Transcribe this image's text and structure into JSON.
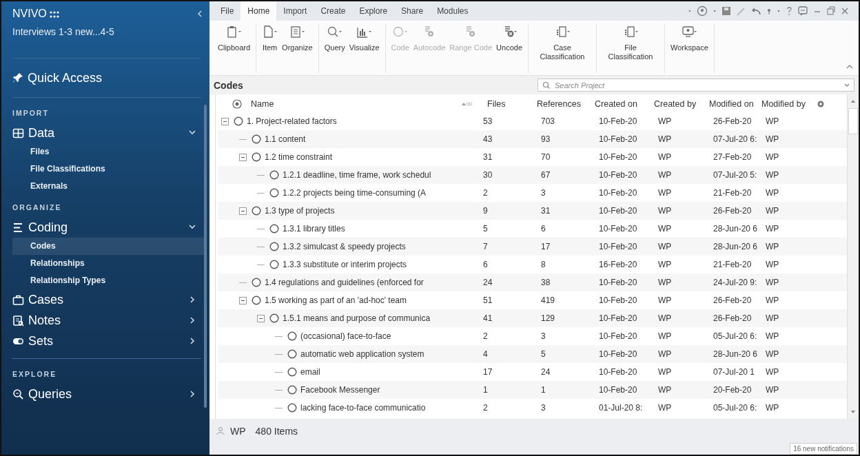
{
  "sidebar": {
    "logo": "NVIVO",
    "project": "Interviews 1-3 new...4-5",
    "quick_access": "Quick Access",
    "sections": [
      {
        "heading": "IMPORT",
        "groups": [
          {
            "label": "Data",
            "expanded": true,
            "children": [
              {
                "label": "Files",
                "selected": false
              },
              {
                "label": "File Classifications",
                "selected": false
              },
              {
                "label": "Externals",
                "selected": false
              }
            ]
          }
        ]
      },
      {
        "heading": "ORGANIZE",
        "groups": [
          {
            "label": "Coding",
            "expanded": true,
            "children": [
              {
                "label": "Codes",
                "selected": true
              },
              {
                "label": "Relationships",
                "selected": false
              },
              {
                "label": "Relationship Types",
                "selected": false
              }
            ]
          },
          {
            "label": "Cases",
            "expanded": false
          },
          {
            "label": "Notes",
            "expanded": false
          },
          {
            "label": "Sets",
            "expanded": false
          }
        ]
      },
      {
        "heading": "EXPLORE",
        "groups": [
          {
            "label": "Queries",
            "expanded": false
          }
        ]
      }
    ]
  },
  "ribbon": {
    "tabs": [
      {
        "label": "File",
        "selected": false
      },
      {
        "label": "Home",
        "selected": true
      },
      {
        "label": "Import",
        "selected": false
      },
      {
        "label": "Create",
        "selected": false
      },
      {
        "label": "Explore",
        "selected": false
      },
      {
        "label": "Share",
        "selected": false
      },
      {
        "label": "Modules",
        "selected": false
      }
    ],
    "groups": [
      [
        {
          "label": "Clipboard",
          "disabled": false
        }
      ],
      [
        {
          "label": "Item",
          "disabled": false
        },
        {
          "label": "Organize",
          "disabled": false
        }
      ],
      [
        {
          "label": "Query",
          "disabled": false
        },
        {
          "label": "Visualize",
          "disabled": false
        }
      ],
      [
        {
          "label": "Code",
          "disabled": true
        },
        {
          "label": "Autocode",
          "disabled": true
        },
        {
          "label": "Range Code",
          "disabled": true
        },
        {
          "label": "Uncode",
          "disabled": false
        }
      ],
      [
        {
          "label": "Case Classification",
          "disabled": false
        }
      ],
      [
        {
          "label": "File Classification",
          "disabled": false
        }
      ],
      [
        {
          "label": "Workspace",
          "disabled": false
        }
      ]
    ]
  },
  "codes": {
    "title": "Codes",
    "search": {
      "placeholder": "Search Project"
    },
    "columns": [
      "Name",
      "Files",
      "References",
      "Created on",
      "Created by",
      "Modified on",
      "Modified by"
    ],
    "rows": [
      {
        "name": "1. Project-related factors",
        "files": "53",
        "references": "703",
        "created_on": "10-Feb-20",
        "created_by": "WP",
        "modified_on": "26-Feb-20",
        "modified_by": "WP",
        "expanded": true,
        "children": [
          {
            "name": "1.1 content",
            "files": "43",
            "references": "93",
            "created_on": "10-Feb-20",
            "created_by": "WP",
            "modified_on": "07-Jul-20 6:",
            "modified_by": "WP"
          },
          {
            "name": "1.2 time constraint",
            "files": "31",
            "references": "70",
            "created_on": "10-Feb-20",
            "created_by": "WP",
            "modified_on": "27-Feb-20",
            "modified_by": "WP",
            "expanded": true,
            "children": [
              {
                "name": "1.2.1 deadline, time frame, work schedul",
                "files": "30",
                "references": "67",
                "created_on": "10-Feb-20",
                "created_by": "WP",
                "modified_on": "07-Jul-20 5:",
                "modified_by": "WP"
              },
              {
                "name": "1.2.2 projects being time-consuming (A",
                "files": "2",
                "references": "3",
                "created_on": "10-Feb-20",
                "created_by": "WP",
                "modified_on": "21-Feb-20",
                "modified_by": "WP"
              }
            ]
          },
          {
            "name": "1.3 type of projects",
            "files": "9",
            "references": "31",
            "created_on": "10-Feb-20",
            "created_by": "WP",
            "modified_on": "26-Feb-20",
            "modified_by": "WP",
            "expanded": true,
            "children": [
              {
                "name": "1.3.1 library titles",
                "files": "5",
                "references": "6",
                "created_on": "10-Feb-20",
                "created_by": "WP",
                "modified_on": "28-Jun-20 6",
                "modified_by": "WP"
              },
              {
                "name": "1.3.2 simulcast & speedy projects",
                "files": "7",
                "references": "17",
                "created_on": "10-Feb-20",
                "created_by": "WP",
                "modified_on": "28-Jun-20 6",
                "modified_by": "WP"
              },
              {
                "name": "1.3.3 substitute or interim projects",
                "files": "6",
                "references": "8",
                "created_on": "16-Feb-20",
                "created_by": "WP",
                "modified_on": "21-Feb-20",
                "modified_by": "WP"
              }
            ]
          },
          {
            "name": "1.4 regulations and guidelines (enforced for",
            "files": "24",
            "references": "38",
            "created_on": "10-Feb-20",
            "created_by": "WP",
            "modified_on": "24-Jul-20 9:",
            "modified_by": "WP"
          },
          {
            "name": "1.5 working as part of an 'ad-hoc' team",
            "files": "51",
            "references": "419",
            "created_on": "10-Feb-20",
            "created_by": "WP",
            "modified_on": "26-Feb-20",
            "modified_by": "WP",
            "expanded": true,
            "children": [
              {
                "name": "1.5.1 means and purpose of communica",
                "files": "41",
                "references": "129",
                "created_on": "10-Feb-20",
                "created_by": "WP",
                "modified_on": "26-Feb-20",
                "modified_by": "WP",
                "expanded": true,
                "children": [
                  {
                    "name": "(occasional) face-to-face",
                    "files": "2",
                    "references": "3",
                    "created_on": "10-Feb-20",
                    "created_by": "WP",
                    "modified_on": "05-Jul-20 6:",
                    "modified_by": "WP"
                  },
                  {
                    "name": "automatic web application system",
                    "files": "4",
                    "references": "5",
                    "created_on": "10-Feb-20",
                    "created_by": "WP",
                    "modified_on": "28-Jun-20 6",
                    "modified_by": "WP"
                  },
                  {
                    "name": "email",
                    "files": "17",
                    "references": "24",
                    "created_on": "10-Feb-20",
                    "created_by": "WP",
                    "modified_on": "07-Jul-20 1",
                    "modified_by": "WP"
                  },
                  {
                    "name": "Facebook Messenger",
                    "files": "1",
                    "references": "1",
                    "created_on": "10-Feb-20",
                    "created_by": "WP",
                    "modified_on": "20-Feb-20",
                    "modified_by": "WP"
                  },
                  {
                    "name": "lacking face-to-face communicatio",
                    "files": "2",
                    "references": "3",
                    "created_on": "01-Jul-20 8:",
                    "created_by": "WP",
                    "modified_on": "05-Jul-20 6:",
                    "modified_by": "WP"
                  }
                ]
              }
            ]
          }
        ]
      }
    ]
  },
  "status_bar": {
    "user": "WP",
    "count": "480 Items",
    "notification": "16 new notifications"
  }
}
